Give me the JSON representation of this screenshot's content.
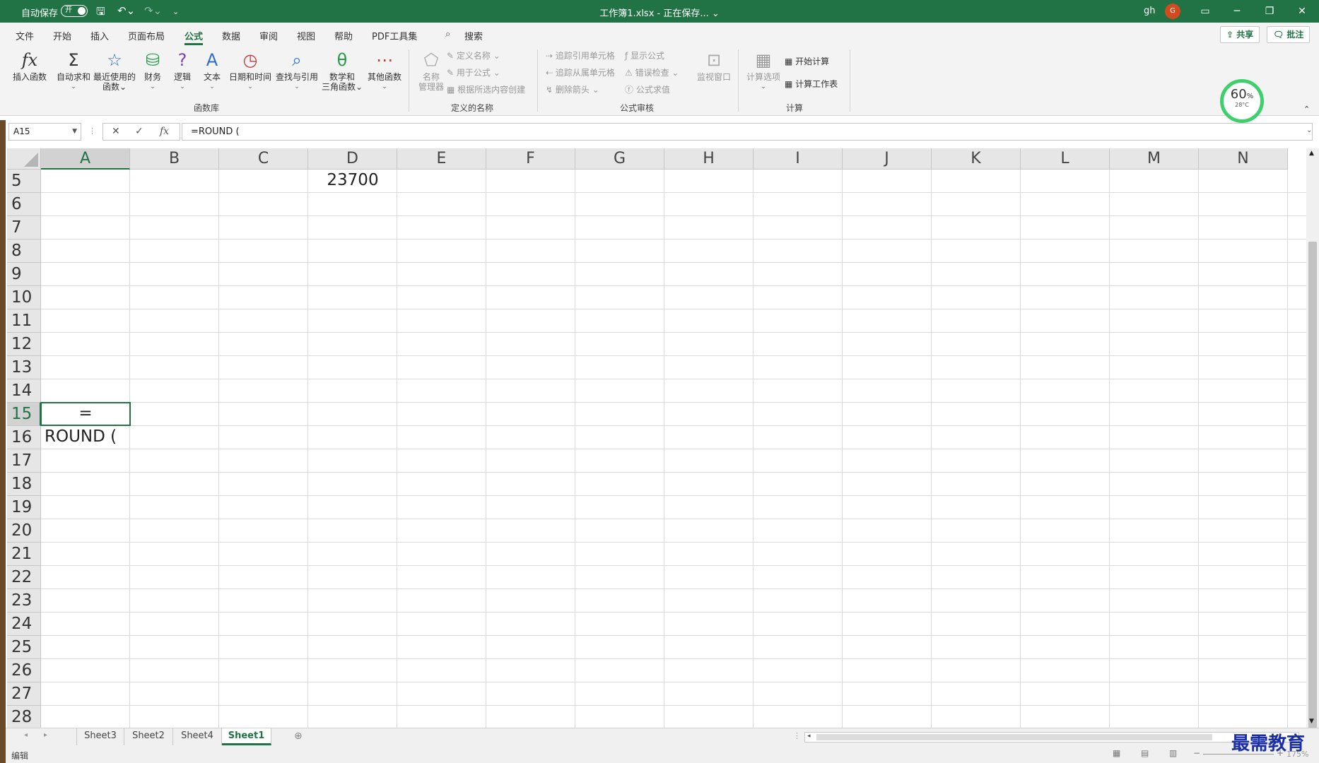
{
  "title": {
    "autosave_label": "自动保存",
    "autosave_state": "开",
    "document": "工作簿1.xlsx - 正在保存... ⌄",
    "user": "gh",
    "avatar_initial": "G"
  },
  "tabs": [
    "文件",
    "开始",
    "插入",
    "页面布局",
    "公式",
    "数据",
    "审阅",
    "视图",
    "帮助",
    "PDF工具集"
  ],
  "search_label": "搜索",
  "share_label": "共享",
  "comment_label": "批注",
  "ribbon": {
    "function_library": {
      "label": "函数库",
      "buttons": [
        "插入函数",
        "自动求和",
        "最近使用的",
        "函数",
        "财务",
        "逻辑",
        "文本",
        "日期和时间",
        "查找与引用",
        "数学和",
        "三角函数",
        "其他函数"
      ]
    },
    "defined_names": {
      "label": "定义的名称",
      "name_manager_1": "名称",
      "name_manager_2": "管理器",
      "define_name": "定义名称",
      "use_in_formula": "用于公式",
      "create_from_selection": "根据所选内容创建"
    },
    "formula_auditing": {
      "label": "公式审核",
      "trace_precedents": "追踪引用单元格",
      "trace_dependents": "追踪从属单元格",
      "remove_arrows": "删除箭头",
      "show_formulas": "显示公式",
      "error_checking": "错误检查",
      "evaluate_formula": "公式求值",
      "watch_window": "监视窗口"
    },
    "calculation": {
      "label": "计算",
      "options": "计算选项",
      "calc_now": "开始计算",
      "calc_sheet": "计算工作表"
    }
  },
  "gauge": {
    "percent": "60",
    "unit": "%",
    "temp": "28°C"
  },
  "formula_bar": {
    "name_box": "A15",
    "formula": "=ROUND ("
  },
  "columns": [
    "A",
    "B",
    "C",
    "D",
    "E",
    "F",
    "G",
    "H",
    "I",
    "J",
    "K",
    "L",
    "M",
    "N"
  ],
  "rows": [
    "5",
    "6",
    "7",
    "8",
    "9",
    "10",
    "11",
    "12",
    "13",
    "14",
    "15",
    "16",
    "17",
    "18",
    "19",
    "20",
    "21",
    "22",
    "23",
    "24",
    "25",
    "26",
    "27",
    "28"
  ],
  "cells": {
    "D5": "23700",
    "A15": "=",
    "A16": "ROUND ("
  },
  "sheets": [
    "Sheet3",
    "Sheet2",
    "Sheet4",
    "Sheet1"
  ],
  "active_sheet": "Sheet1",
  "status": {
    "mode": "编辑",
    "zoom": "175%"
  },
  "watermark": "最需教育"
}
